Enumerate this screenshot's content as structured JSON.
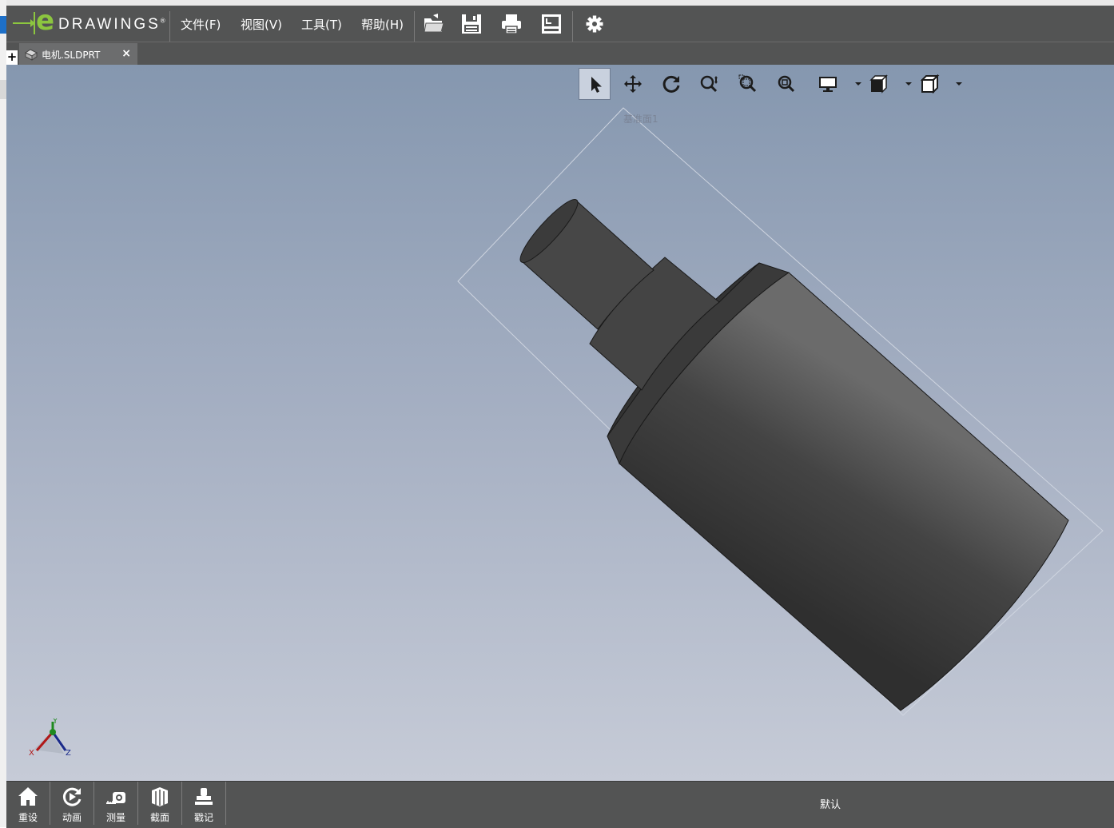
{
  "app": {
    "logo_e": "e",
    "logo_word": "DRAWINGS",
    "logo_reg": "®"
  },
  "menu": [
    {
      "label": "文件(F)"
    },
    {
      "label": "视图(V)"
    },
    {
      "label": "工具(T)"
    },
    {
      "label": "帮助(H)"
    }
  ],
  "toolbar_icons": [
    "open-icon",
    "save-icon",
    "print-icon",
    "markup-icon",
    "settings-icon"
  ],
  "tab": {
    "label": "电机.SLDPRT",
    "close": "×",
    "add": "+"
  },
  "view_tools": [
    "select-icon",
    "pan-icon",
    "rotate-icon",
    "zoom-icon",
    "zoom-area-icon",
    "zoom-fit-icon",
    "display-icon",
    "views-icon",
    "view-orientation-icon"
  ],
  "viewport": {
    "plane_label": "基准面1",
    "model_color": "#3e3e3e",
    "background_top": "#8597af",
    "background_bottom": "#c6cbd7"
  },
  "triad": {
    "x": "X",
    "y": "Y",
    "z": "Z"
  },
  "bottom": {
    "buttons": [
      {
        "label": "重设"
      },
      {
        "label": "动画"
      },
      {
        "label": "测量"
      },
      {
        "label": "截面"
      },
      {
        "label": "戳记"
      }
    ],
    "config": "默认"
  }
}
